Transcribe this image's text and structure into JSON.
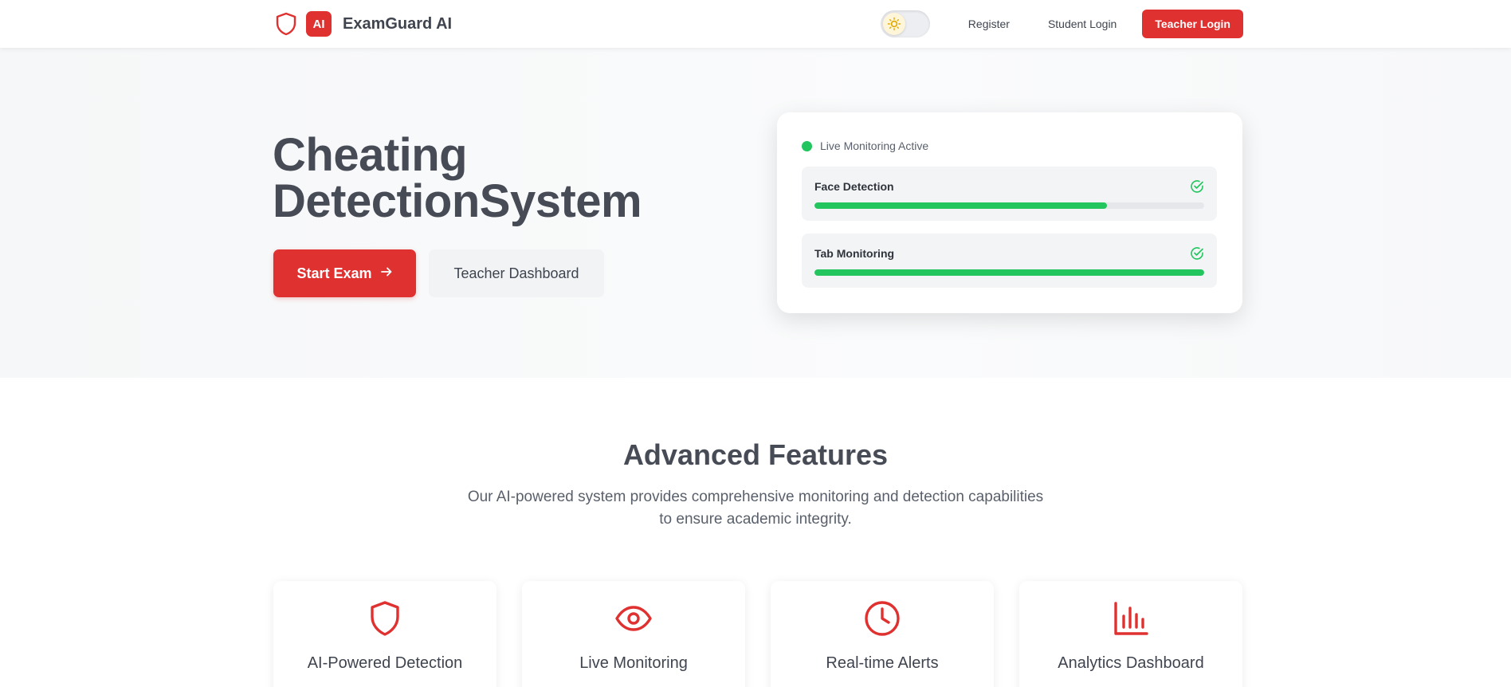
{
  "colors": {
    "accent": "#e03131",
    "success": "#22c55e",
    "text_dark": "#464b55"
  },
  "navbar": {
    "brand_badge": "AI",
    "brand_name": "ExamGuard AI",
    "theme_toggle_icon": "sun-icon",
    "links": {
      "register": "Register",
      "student_login": "Student Login"
    },
    "teacher_login": "Teacher Login"
  },
  "hero": {
    "title_line1": "Cheating",
    "title_line2": "DetectionSystem",
    "start_exam": "Start Exam",
    "teacher_dashboard": "Teacher Dashboard"
  },
  "monitor": {
    "status": "Live Monitoring Active",
    "metrics": [
      {
        "label": "Face Detection",
        "progress": 0.75
      },
      {
        "label": "Tab Monitoring",
        "progress": 1.0
      }
    ]
  },
  "features": {
    "title": "Advanced Features",
    "description_line1": "Our AI-powered system provides comprehensive monitoring and detection capabilities",
    "description_line2": "to ensure academic integrity.",
    "cards": [
      {
        "icon": "shield-icon",
        "title": "AI-Powered Detection"
      },
      {
        "icon": "eye-icon",
        "title": "Live Monitoring"
      },
      {
        "icon": "clock-icon",
        "title": "Real-time Alerts"
      },
      {
        "icon": "bar-chart-icon",
        "title": "Analytics Dashboard"
      }
    ]
  }
}
